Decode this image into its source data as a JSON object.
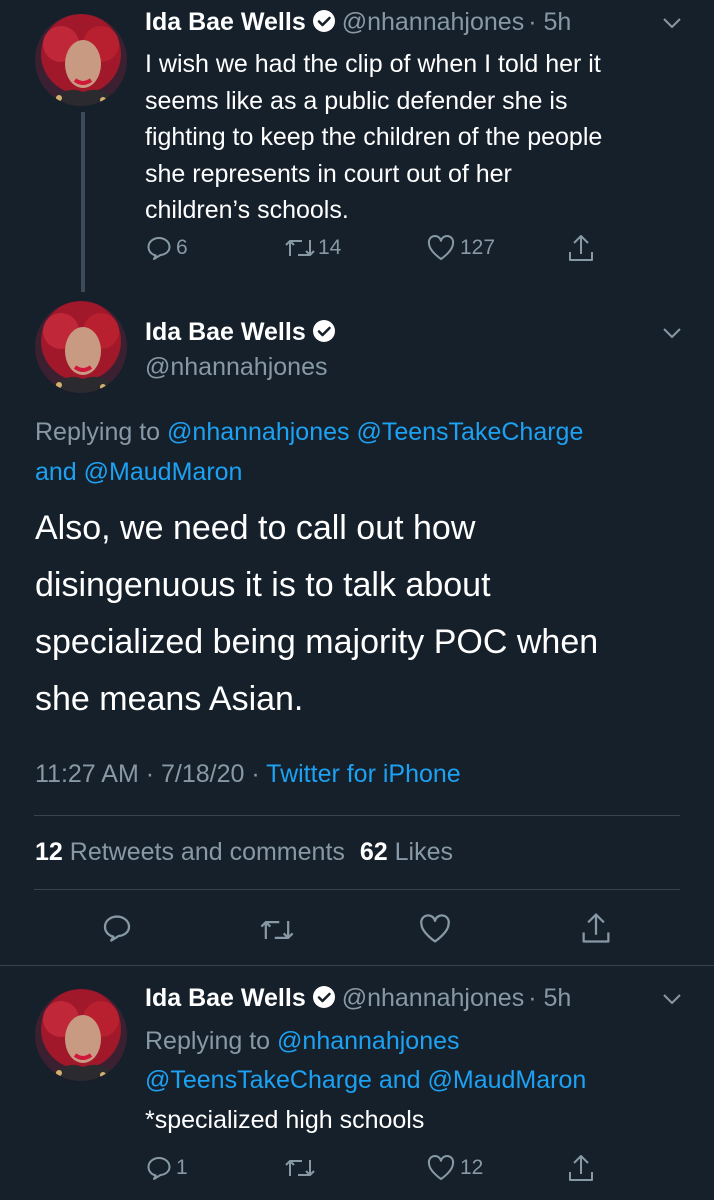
{
  "tweet1": {
    "name": "Ida Bae Wells",
    "handle": "@nhannahjones",
    "time": "· 5h",
    "lines": [
      "I wish we had the clip of when I told her it",
      "seems like as a public defender she is",
      "fighting to keep the children of the people",
      "she represents in court out of her",
      "children’s schools."
    ],
    "replies": "6",
    "retweets": "14",
    "likes": "127"
  },
  "tweet2": {
    "name": "Ida Bae Wells",
    "handle": "@nhannahjones",
    "replying_prefix": "Replying to ",
    "reply_handle1": "@nhannahjones",
    "reply_handle2": "@TeensTakeCharge",
    "reply_and": "and ",
    "reply_handle3": "@MaudMaron",
    "lines": [
      "Also, we need to call out how",
      "disingenuous it is to talk about",
      "specialized being majority POC when",
      "she means Asian."
    ],
    "timestamp": "11:27 AM · 7/18/20 · ",
    "source": "Twitter for iPhone",
    "retweet_count": "12",
    "retweet_label": "Retweets and comments",
    "like_count": "62",
    "like_label": "Likes"
  },
  "tweet3": {
    "name": "Ida Bae Wells",
    "handle": "@nhannahjones",
    "time": "· 5h",
    "replying_prefix": "Replying to ",
    "reply_handle1": "@nhannahjones",
    "reply_handle2": "@TeensTakeCharge",
    "reply_and": " and ",
    "reply_handle3": "@MaudMaron",
    "text": "*specialized high schools",
    "replies": "1",
    "likes": "12"
  },
  "colors": {
    "background": "#15202b",
    "link": "#1da1f2",
    "muted": "#8899a6",
    "divider": "#38444d"
  },
  "icons": [
    "verified-icon",
    "chevron-down-icon",
    "reply-icon",
    "retweet-icon",
    "like-icon",
    "share-icon"
  ]
}
